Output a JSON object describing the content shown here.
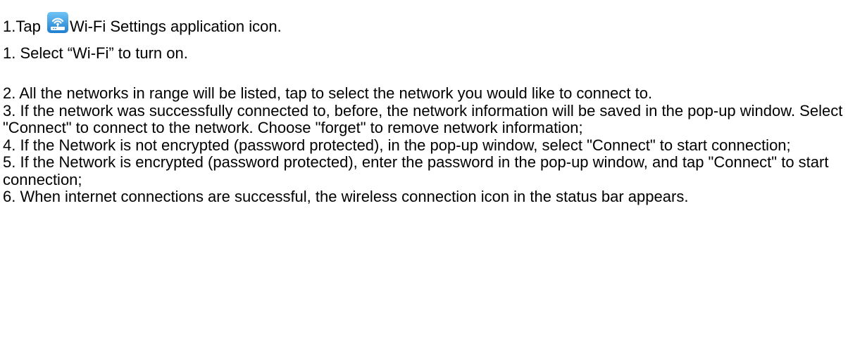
{
  "step_intro": {
    "prefix": "1.Tap ",
    "icon": "wifi-settings-app-icon",
    "suffix": "Wi-Fi Settings application icon."
  },
  "step_select": "1. Select “Wi-Fi” to turn on.",
  "steps": [
    "2. All the networks in range will be listed, tap to select the network you would like to connect to.",
    "3. If the network was successfully connected to, before, the network information will be saved in the pop-up window. Select \"Connect\" to connect to the network. Choose \"forget\" to remove network information;",
    "4. If the Network is not encrypted (password protected), in the pop-up window, select \"Connect\" to start connection;",
    "5. If the Network is encrypted (password protected), enter the password in the pop-up window, and tap \"Connect\" to start connection;",
    "6. When internet connections are successful, the wireless connection icon in the status bar appears."
  ]
}
